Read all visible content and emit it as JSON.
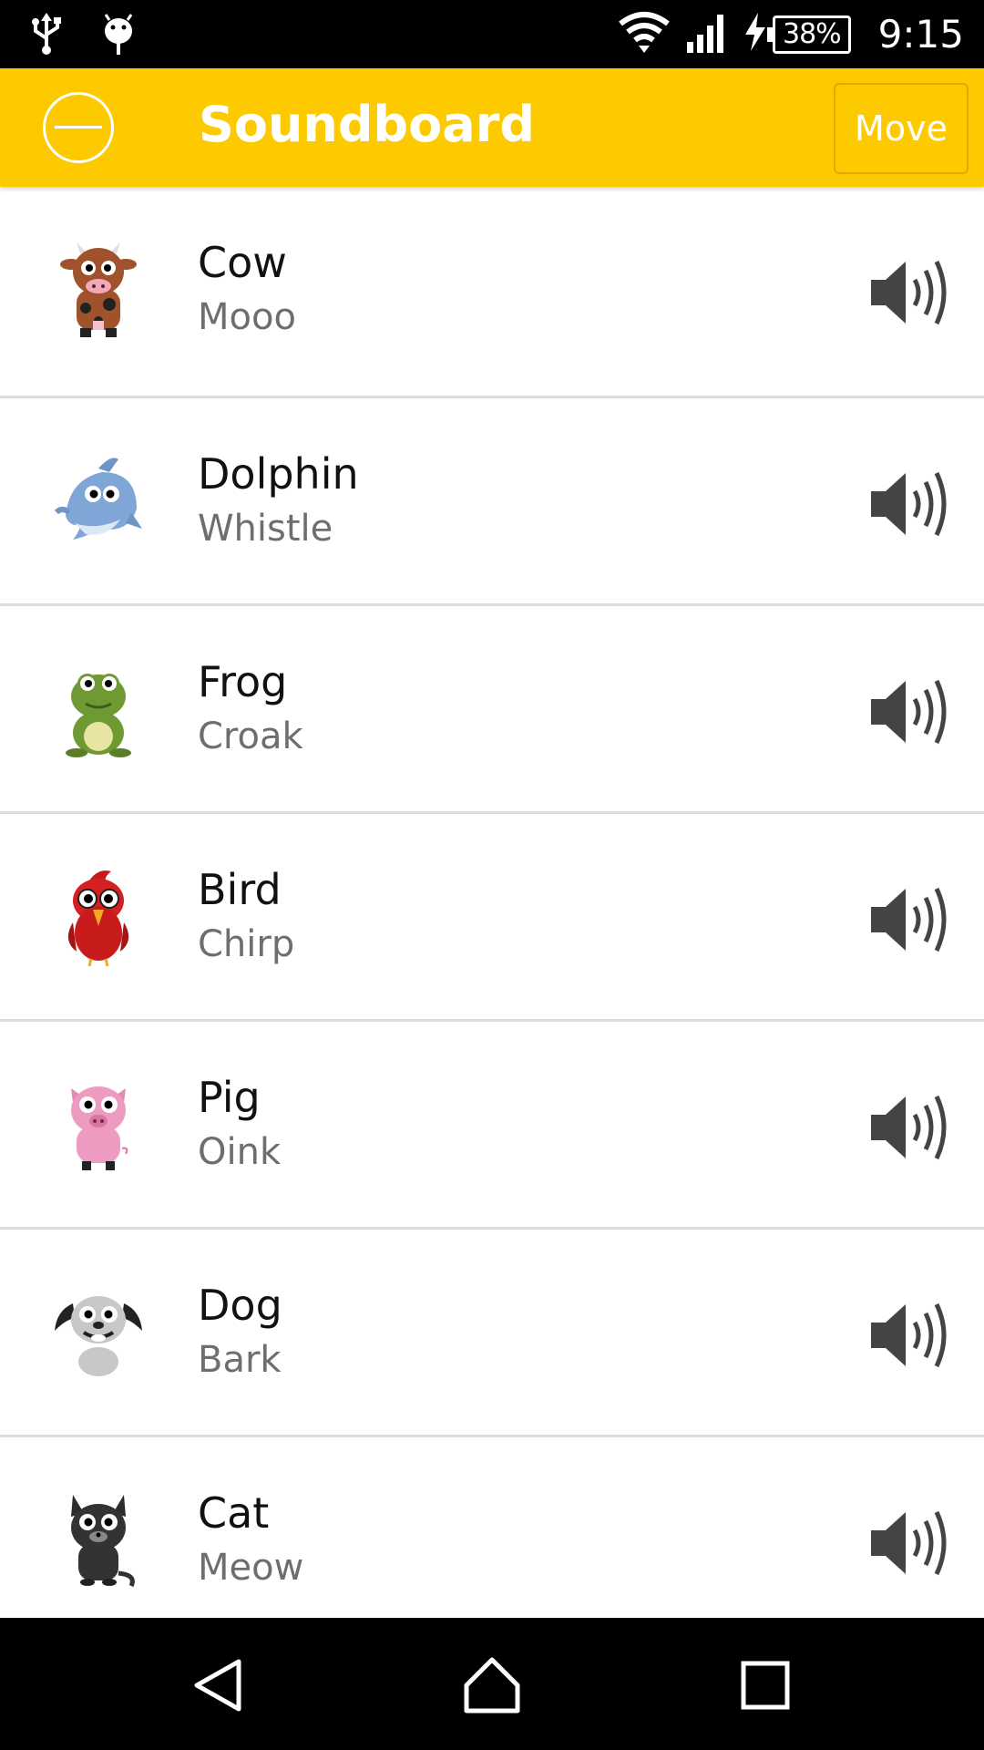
{
  "status_bar": {
    "battery": "38%",
    "time": "9:15",
    "icons": [
      "usb-icon",
      "android-debug-icon",
      "wifi-icon",
      "signal-icon",
      "charging-icon",
      "battery-icon"
    ]
  },
  "app_bar": {
    "title": "Soundboard",
    "move_label": "Move",
    "background": "#FDCA00"
  },
  "sounds": [
    {
      "name": "Cow",
      "sound": "Mooo",
      "icon": "cow-icon"
    },
    {
      "name": "Dolphin",
      "sound": "Whistle",
      "icon": "dolphin-icon"
    },
    {
      "name": "Frog",
      "sound": "Croak",
      "icon": "frog-icon"
    },
    {
      "name": "Bird",
      "sound": "Chirp",
      "icon": "bird-icon"
    },
    {
      "name": "Pig",
      "sound": "Oink",
      "icon": "pig-icon"
    },
    {
      "name": "Dog",
      "sound": "Bark",
      "icon": "dog-icon"
    },
    {
      "name": "Cat",
      "sound": "Meow",
      "icon": "cat-icon"
    }
  ],
  "nav_bar": {
    "icons": [
      "back-icon",
      "home-icon",
      "recents-icon"
    ]
  }
}
